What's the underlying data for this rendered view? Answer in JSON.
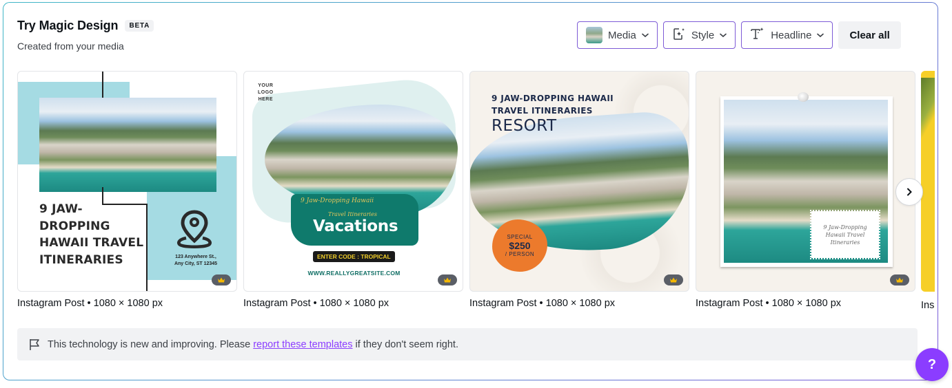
{
  "header": {
    "title": "Try Magic Design",
    "badge": "BETA",
    "subtitle": "Created from your media"
  },
  "filters": {
    "media_label": "Media",
    "style_label": "Style",
    "headline_label": "Headline",
    "clear_label": "Clear all"
  },
  "templates": [
    {
      "label": "Instagram Post • 1080 × 1080 px",
      "premium": true,
      "headline": [
        "9 JAW-",
        "DROPPING",
        "HAWAII TRAVEL",
        "ITINERARIES"
      ],
      "address": [
        "123 Anywhere St.,",
        "Any City, ST 12345"
      ]
    },
    {
      "label": "Instagram Post • 1080 × 1080 px",
      "premium": true,
      "logo": [
        "YOUR",
        "LOGO",
        "HERE"
      ],
      "script_line1": "9 Jaw-Dropping Hawaii",
      "script_line2": "Travel Itineraries",
      "headline": "Vacations",
      "code": "ENTER CODE : TROPICAL",
      "site": "WWW.REALLYGREATSITE.COM"
    },
    {
      "label": "Instagram Post • 1080 × 1080 px",
      "premium": true,
      "headline_line1": "9 JAW-DROPPING HAWAII",
      "headline_line2": "TRAVEL ITINERARIES",
      "subhead": "RESORT",
      "badge_top": "SPECIAL",
      "badge_price": "$250",
      "badge_bottom": "/ PERSON"
    },
    {
      "label": "Instagram Post • 1080 × 1080 px",
      "premium": true,
      "stamp_text": [
        "9 Jaw-Dropping",
        "Hawaii Travel",
        "Itineraries"
      ]
    },
    {
      "label": "Ins"
    }
  ],
  "carousel": {
    "next_icon": "chevron-right-icon"
  },
  "notice": {
    "icon": "flag-icon",
    "text_before": "This technology is new and improving. Please ",
    "link_text": "report these templates",
    "text_after": " if they don't seem right."
  },
  "help": {
    "label": "?"
  },
  "colors": {
    "accent": "#8b3dff",
    "control_border": "#7d5ad6",
    "notice_bg": "#f1f2f4",
    "premium_badge": "#5a5e66",
    "crown": "#f5b800"
  }
}
